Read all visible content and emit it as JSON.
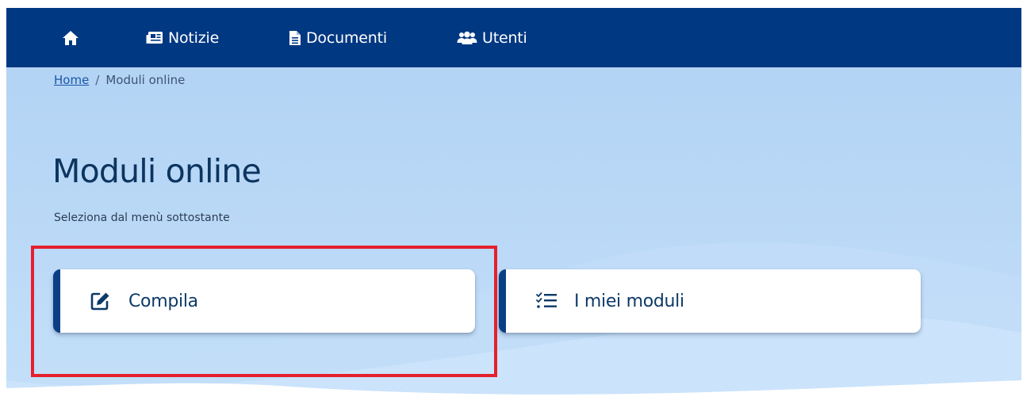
{
  "nav": {
    "home_icon": "home-icon",
    "items": [
      {
        "label": "Notizie",
        "icon": "newspaper-icon"
      },
      {
        "label": "Documenti",
        "icon": "document-icon"
      },
      {
        "label": "Utenti",
        "icon": "users-icon"
      }
    ]
  },
  "breadcrumb": {
    "home": "Home",
    "separator": "/",
    "current": "Moduli online"
  },
  "page": {
    "title": "Moduli online",
    "subtitle": "Seleziona dal menù sottostante"
  },
  "cards": [
    {
      "label": "Compila",
      "icon": "edit-icon"
    },
    {
      "label": "I miei moduli",
      "icon": "checklist-icon"
    }
  ],
  "colors": {
    "nav_bg": "#003882",
    "accent": "#0a3f86",
    "background": "#b1d2f4",
    "highlight": "#e5202e"
  }
}
